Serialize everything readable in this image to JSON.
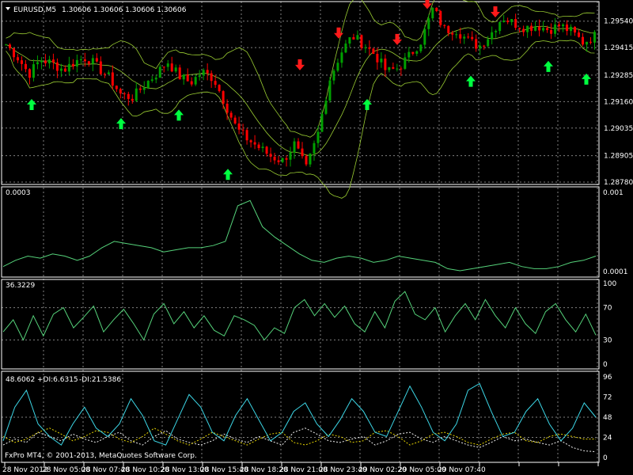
{
  "window": {
    "title": "EURUSD,M5",
    "ohlc": "1.30606 1.30606 1.30606 1.30606",
    "copyright": "FxPro MT4, © 2001-2013, MetaQuotes Software Corp."
  },
  "colors": {
    "background": "#000000",
    "grid": "#808080",
    "bull_candle": "#00a000",
    "bear_candle": "#ff0000",
    "bands": "#9acd32",
    "indicator_line": "#55d27a",
    "adx": "#3cd6e6",
    "plus_di": "#f0f0f0",
    "minus_di": "#e6d400",
    "up_arrow": "#00ff40",
    "down_arrow": "#ff1a1a",
    "text": "#ffffff"
  },
  "chart_data": [
    {
      "type": "candlestick",
      "symbol": "EURUSD",
      "timeframe": "M5",
      "ylim": [
        1.2878,
        1.2961
      ],
      "yticks": [
        "1.29540",
        "1.29415",
        "1.29285",
        "1.29160",
        "1.29035",
        "1.28905",
        "1.28780"
      ],
      "xticks": [
        "28 Nov 2012",
        "28 Nov 05:00",
        "28 Nov 07:40",
        "28 Nov 10:20",
        "28 Nov 13:00",
        "28 Nov 15:40",
        "28 Nov 18:20",
        "28 Nov 21:00",
        "28 Nov 23:40",
        "29 Nov 02:20",
        "29 Nov 05:00",
        "29 Nov 07:40"
      ],
      "close_path": [
        1.2943,
        1.2937,
        1.2929,
        1.2936,
        1.2934,
        1.2931,
        1.2935,
        1.2937,
        1.2932,
        1.2927,
        1.2919,
        1.2918,
        1.2924,
        1.2929,
        1.2935,
        1.2928,
        1.2925,
        1.293,
        1.2927,
        1.2915,
        1.2903,
        1.2898,
        1.2894,
        1.289,
        1.2888,
        1.2896,
        1.2884,
        1.29,
        1.2926,
        1.2939,
        1.2947,
        1.2943,
        1.2938,
        1.293,
        1.2932,
        1.2938,
        1.2945,
        1.296,
        1.295,
        1.295,
        1.2945,
        1.2942,
        1.2948,
        1.2956,
        1.2953,
        1.2951,
        1.2952,
        1.295,
        1.2952,
        1.2949,
        1.2944,
        1.2947
      ],
      "up_arrows": [
        1.2918,
        1.2909,
        1.2913,
        1.2885,
        1.2918,
        1.2929,
        1.2936,
        1.293
      ],
      "down_arrows": [
        1.293,
        1.2945,
        1.2942,
        1.2959,
        1.2955
      ]
    },
    {
      "type": "line",
      "label": "0.0003",
      "yticks": [
        "0.001",
        "0.0001"
      ],
      "values": [
        0.00012,
        0.00018,
        0.00022,
        0.0002,
        0.00024,
        0.00022,
        0.00018,
        0.00022,
        0.0003,
        0.00036,
        0.00034,
        0.00032,
        0.0003,
        0.00026,
        0.00028,
        0.0003,
        0.0003,
        0.00032,
        0.00036,
        0.0007,
        0.00075,
        0.0005,
        0.0004,
        0.00032,
        0.00024,
        0.00018,
        0.00016,
        0.0002,
        0.00022,
        0.0002,
        0.00016,
        0.00018,
        0.00022,
        0.0002,
        0.00018,
        0.00016,
        0.0001,
        8e-05,
        0.0001,
        0.00012,
        0.00014,
        0.00016,
        0.00012,
        0.0001,
        0.0001,
        0.00012,
        0.00016,
        0.00018,
        0.00022
      ]
    },
    {
      "type": "line",
      "label": "36.3229",
      "ylim": [
        0,
        100
      ],
      "yticks": [
        "100",
        "70",
        "30",
        "0"
      ],
      "values": [
        40,
        55,
        30,
        60,
        35,
        62,
        70,
        45,
        58,
        72,
        40,
        55,
        68,
        50,
        30,
        62,
        75,
        50,
        65,
        45,
        60,
        42,
        35,
        60,
        55,
        48,
        30,
        45,
        38,
        70,
        80,
        60,
        75,
        58,
        72,
        50,
        40,
        65,
        45,
        78,
        90,
        62,
        55,
        70,
        40,
        60,
        75,
        55,
        80,
        60,
        45,
        70,
        50,
        38,
        65,
        75,
        55,
        40,
        62,
        36
      ]
    },
    {
      "type": "line",
      "label": "48.6062",
      "legend": [
        "+DI:6.6315",
        "-DI:21.5386"
      ],
      "ylim": [
        0,
        96
      ],
      "yticks": [
        "96",
        "72",
        "48",
        "24",
        "0"
      ],
      "series": [
        {
          "values": [
            20,
            60,
            80,
            40,
            25,
            15,
            40,
            60,
            35,
            25,
            40,
            70,
            50,
            20,
            15,
            45,
            75,
            60,
            30,
            20,
            50,
            70,
            45,
            20,
            30,
            55,
            65,
            40,
            25,
            45,
            70,
            55,
            30,
            25,
            55,
            85,
            60,
            30,
            20,
            40,
            80,
            88,
            55,
            25,
            30,
            55,
            70,
            40,
            20,
            35,
            65,
            48
          ]
        },
        {
          "values": [
            15,
            22,
            18,
            30,
            25,
            20,
            28,
            22,
            18,
            25,
            30,
            20,
            15,
            25,
            32,
            22,
            18,
            15,
            20,
            28,
            22,
            18,
            25,
            20,
            15,
            30,
            35,
            28,
            20,
            18,
            22,
            25,
            15,
            20,
            28,
            30,
            22,
            18,
            25,
            20,
            15,
            12,
            18,
            25,
            20,
            22,
            18,
            15,
            20,
            12,
            8,
            7
          ]
        },
        {
          "values": [
            25,
            18,
            22,
            30,
            35,
            28,
            20,
            25,
            32,
            30,
            22,
            18,
            25,
            35,
            28,
            20,
            15,
            22,
            30,
            25,
            20,
            15,
            22,
            28,
            30,
            18,
            15,
            20,
            28,
            25,
            18,
            20,
            30,
            32,
            25,
            15,
            20,
            28,
            30,
            25,
            18,
            15,
            22,
            28,
            30,
            20,
            18,
            25,
            28,
            25,
            22,
            22
          ]
        }
      ]
    }
  ]
}
